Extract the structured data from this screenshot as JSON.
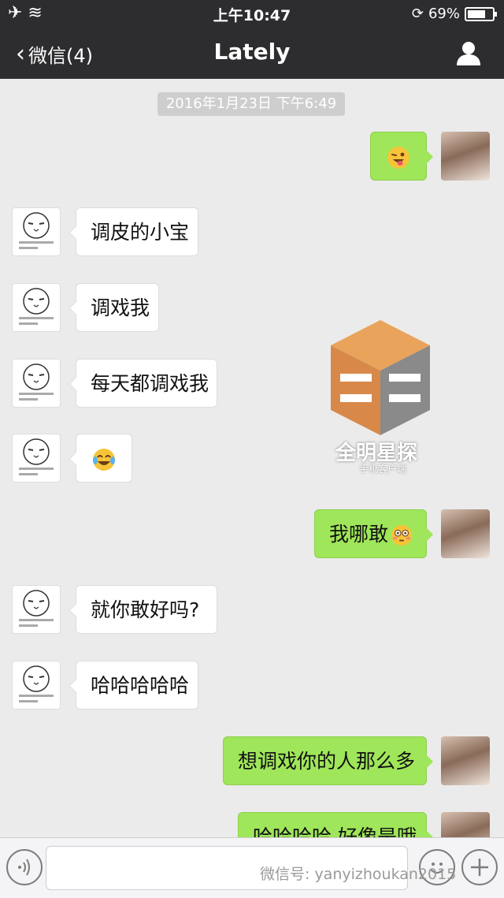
{
  "status_bar": {
    "time": "上午10:47",
    "battery": "69%"
  },
  "nav": {
    "back_label": "微信(4)",
    "title": "Lately"
  },
  "timestamp": "2016年1月23日 下午6:49",
  "messages": [
    {
      "side": "right",
      "text": ""
    },
    {
      "side": "left",
      "text": "调皮的小宝"
    },
    {
      "side": "left",
      "text": "调戏我"
    },
    {
      "side": "left",
      "text": "每天都调戏我"
    },
    {
      "side": "left",
      "text": ""
    },
    {
      "side": "right",
      "text": "我哪敢"
    },
    {
      "side": "left",
      "text": "就你敢好吗?"
    },
    {
      "side": "left",
      "text": "哈哈哈哈哈"
    },
    {
      "side": "right",
      "text": "想调戏你的人那么多"
    },
    {
      "side": "right",
      "text": "哈哈哈哈 好像是哦"
    }
  ],
  "watermark": {
    "title": "全明星探",
    "subtitle": "手机客户端"
  },
  "footer_watermark": "微信号: yanyizhoukan2015",
  "colors": {
    "bar": "#2d2d30",
    "background": "#ebebeb",
    "my_bubble": "#9fe65a",
    "their_bubble": "#ffffff"
  }
}
